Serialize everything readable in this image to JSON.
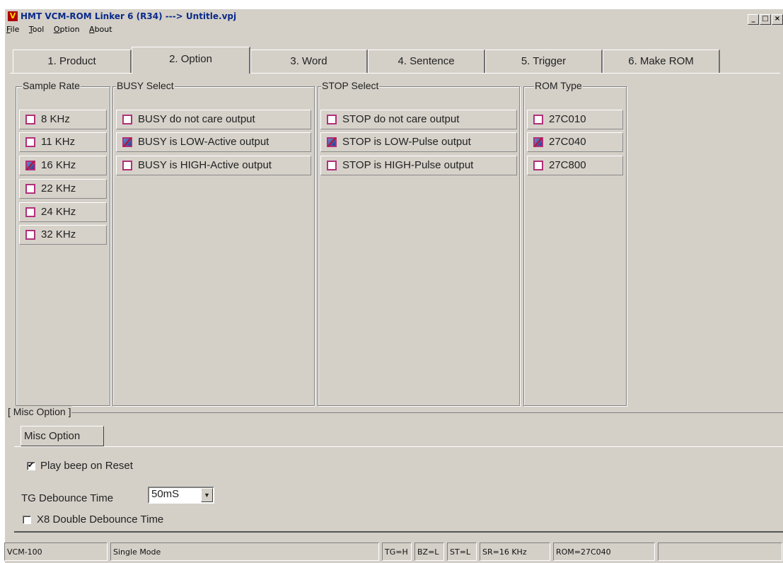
{
  "window": {
    "title": "HMT VCM-ROM Linker 6  (R34) ---> Untitle.vpj",
    "app_icon": "V",
    "controls": [
      "_",
      "□",
      "×"
    ]
  },
  "menu": {
    "items": [
      {
        "mnemonic": "F",
        "rest": "ile"
      },
      {
        "mnemonic": "T",
        "rest": "ool"
      },
      {
        "mnemonic": "O",
        "rest": "ption"
      },
      {
        "mnemonic": "A",
        "rest": "bout"
      }
    ]
  },
  "tabs": [
    {
      "label": "1. Product"
    },
    {
      "label": "2. Option"
    },
    {
      "label": "3. Word"
    },
    {
      "label": "4. Sentence"
    },
    {
      "label": "5. Trigger"
    },
    {
      "label": "6. Make ROM"
    }
  ],
  "active_tab": "2. Option",
  "groups": {
    "sample_rate": {
      "title": "Sample Rate",
      "options": [
        {
          "label": "8 KHz",
          "checked": false
        },
        {
          "label": "11 KHz",
          "checked": false
        },
        {
          "label": "16 KHz",
          "checked": true
        },
        {
          "label": "22 KHz",
          "checked": false
        },
        {
          "label": "24 KHz",
          "checked": false
        },
        {
          "label": "32 KHz",
          "checked": false
        }
      ]
    },
    "busy_select": {
      "title": "BUSY Select",
      "options": [
        {
          "label": "BUSY do not care output",
          "checked": false
        },
        {
          "label": "BUSY is LOW-Active output",
          "checked": true
        },
        {
          "label": "BUSY is HIGH-Active output",
          "checked": false
        }
      ]
    },
    "stop_select": {
      "title": "STOP Select",
      "options": [
        {
          "label": "STOP do not care output",
          "checked": false
        },
        {
          "label": "STOP is LOW-Pulse output",
          "checked": true
        },
        {
          "label": "STOP is HIGH-Pulse output",
          "checked": false
        }
      ]
    },
    "rom_type": {
      "title": "ROM Type",
      "options": [
        {
          "label": "27C010",
          "checked": false
        },
        {
          "label": "27C040",
          "checked": true
        },
        {
          "label": "27C800",
          "checked": false
        }
      ]
    }
  },
  "misc": {
    "group_title": "[ Misc Option ]",
    "tab_label": "Misc Option",
    "play_beep": {
      "label": "Play beep on Reset",
      "checked": true
    },
    "tg_debounce": {
      "label": "TG Debounce Time",
      "value": "50mS"
    },
    "x8_double": {
      "label": "X8 Double Debounce Time",
      "checked": false
    }
  },
  "status": {
    "device": "VCM-100",
    "mode": "Single Mode",
    "tg": "TG=H",
    "bz": "BZ=L",
    "st": "ST=L",
    "sr": "SR=16 KHz",
    "rom": "ROM=27C040",
    "extra": ""
  }
}
